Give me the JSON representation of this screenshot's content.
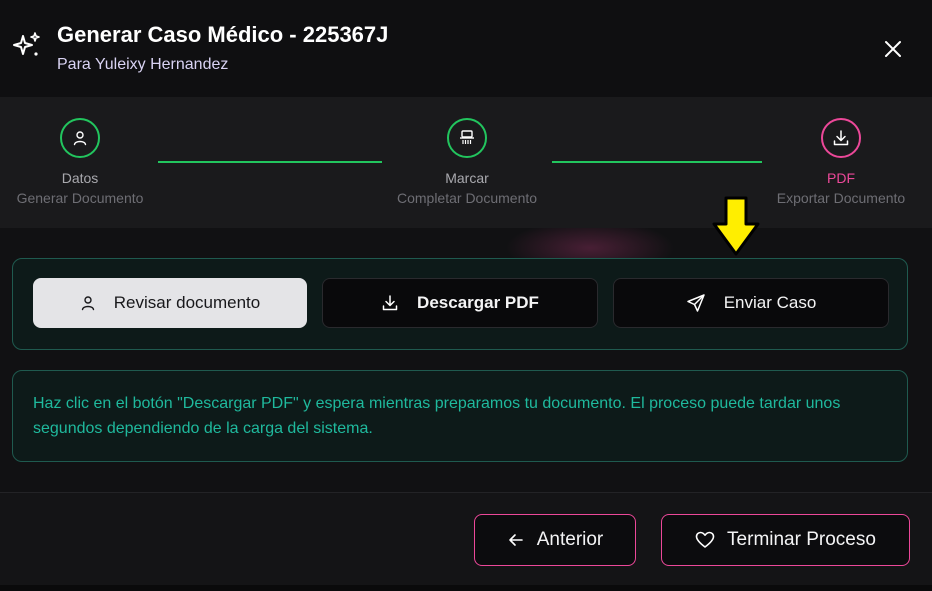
{
  "header": {
    "title": "Generar Caso Médico - 225367J",
    "subtitle": "Para Yuleixy Hernandez",
    "icon": "sparkles-icon",
    "close_icon": "close-icon"
  },
  "stepper": {
    "steps": [
      {
        "label": "Datos",
        "description": "Generar Documento",
        "icon": "user-icon",
        "state": "completed"
      },
      {
        "label": "Marcar",
        "description": "Completar Documento",
        "icon": "stamp-icon",
        "state": "completed"
      },
      {
        "label": "PDF",
        "description": "Exportar Documento",
        "icon": "download-icon",
        "state": "active"
      }
    ],
    "colors": {
      "completed": "#22c55e",
      "active": "#ec4899"
    }
  },
  "actions": {
    "review_label": "Revisar documento",
    "download_label": "Descargar PDF",
    "send_label": "Enviar Caso"
  },
  "info": {
    "text": "Haz clic en el botón \"Descargar PDF\" y espera mientras preparamos tu documento. El proceso puede tardar unos segundos dependiendo de la carga del sistema."
  },
  "footer": {
    "previous_label": "Anterior",
    "finish_label": "Terminar Proceso"
  },
  "annotation": {
    "arrow_color": "#ffee00"
  }
}
